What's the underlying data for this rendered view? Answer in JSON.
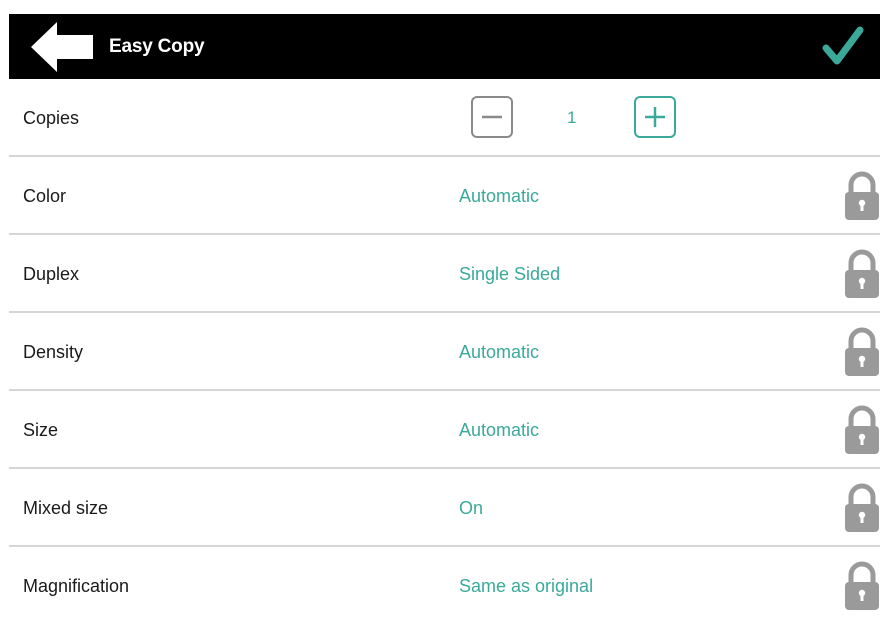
{
  "header": {
    "title": "Easy Copy",
    "back_icon": "back-arrow-icon",
    "confirm_icon": "checkmark-icon"
  },
  "copies": {
    "label": "Copies",
    "value": "1",
    "decrement_icon": "minus-icon",
    "increment_icon": "plus-icon"
  },
  "settings": [
    {
      "label": "Color",
      "value": "Automatic",
      "icon": "lock-icon"
    },
    {
      "label": "Duplex",
      "value": "Single Sided",
      "icon": "lock-icon"
    },
    {
      "label": "Density",
      "value": "Automatic",
      "icon": "lock-icon"
    },
    {
      "label": "Size",
      "value": "Automatic",
      "icon": "lock-icon"
    },
    {
      "label": "Mixed size",
      "value": "On",
      "icon": "lock-icon"
    },
    {
      "label": "Magnification",
      "value": "Same as original",
      "icon": "lock-icon"
    }
  ],
  "colors": {
    "header_bg": "#000000",
    "accent": "#3aa99a",
    "lock_gray": "#9a9a9a",
    "divider": "#d6d6d6"
  }
}
